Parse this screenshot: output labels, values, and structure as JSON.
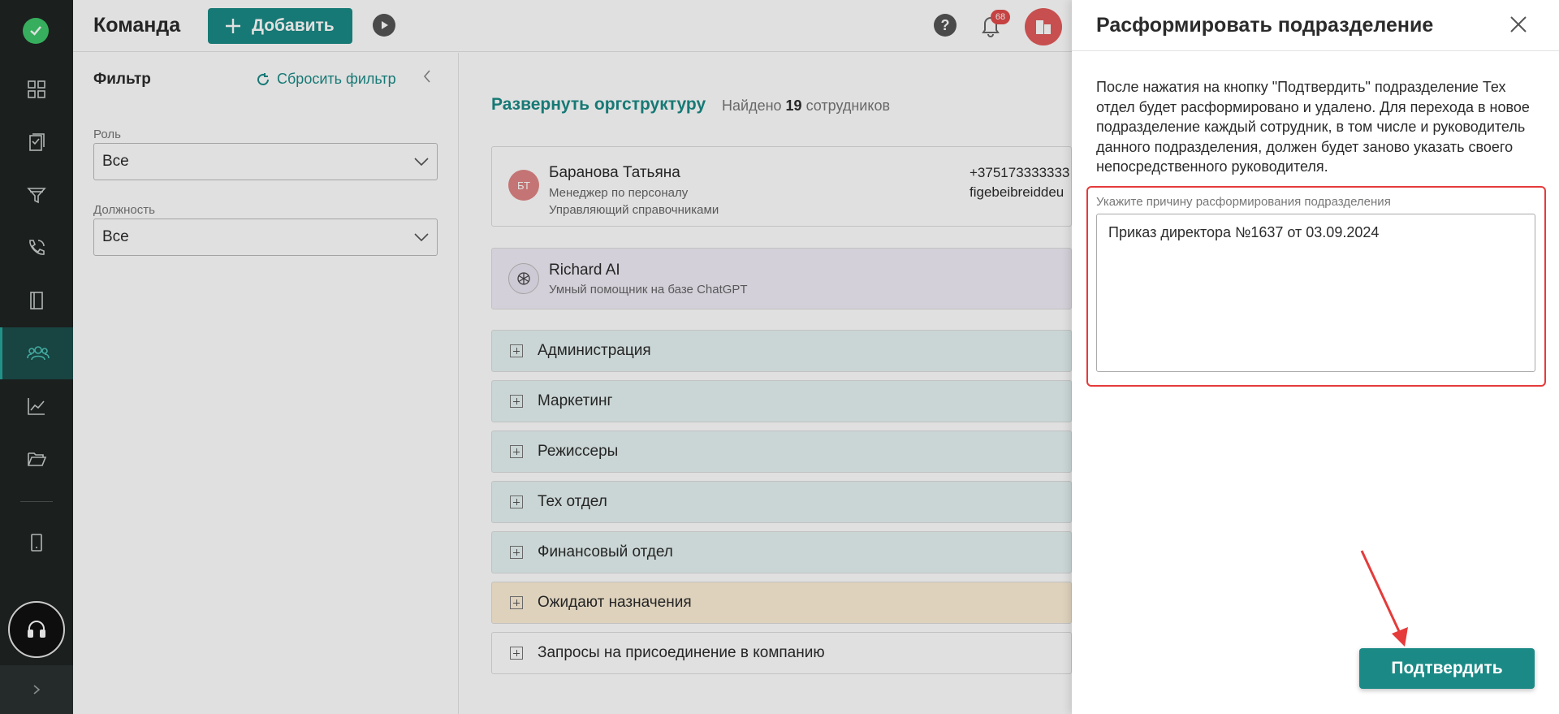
{
  "header": {
    "title": "Команда",
    "add_label": "Добавить",
    "notifications_count": "68"
  },
  "filter": {
    "title": "Фильтр",
    "reset_label": "Сбросить фильтр",
    "role_label": "Роль",
    "role_value": "Все",
    "position_label": "Должность",
    "position_value": "Все"
  },
  "main": {
    "expand_label": "Развернуть оргструктуру",
    "found_prefix": "Найдено",
    "found_count": "19",
    "found_suffix": "сотрудников",
    "employees": [
      {
        "initials": "БТ",
        "name": "Баранова Татьяна",
        "role": "Менеджер по персоналу",
        "extra": "Управляющий справочниками",
        "phone": "+375173333333",
        "email": "figebeibreiddeu"
      },
      {
        "initials": "",
        "name": "Richard AI",
        "role": "Умный помощник на базе ChatGPT",
        "extra": "",
        "phone": "",
        "email": ""
      }
    ],
    "departments": [
      "Администрация",
      "Маркетинг",
      "Режиссеры",
      "Тех отдел",
      "Финансовый отдел",
      "Ожидают назначения",
      "Запросы на присоединение в компанию"
    ]
  },
  "drawer": {
    "title": "Расформировать подразделение",
    "description": "После нажатия на кнопку \"Подтвердить\" подразделение Тех отдел будет расформировано и удалено. Для перехода в новое подразделение каждый сотрудник, в том числе и руководитель данного подразделения, должен будет заново указать своего непосредственного руководителя.",
    "reason_label": "Укажите причину расформирования подразделения",
    "reason_value": "Приказ директора №1637 от 03.09.2024",
    "confirm_label": "Подтвердить"
  },
  "colors": {
    "accent": "#1b8a86",
    "rail_bg": "#1f2423",
    "highlight_red": "#e53b3b",
    "pending_bg": "#fdf0d8"
  }
}
